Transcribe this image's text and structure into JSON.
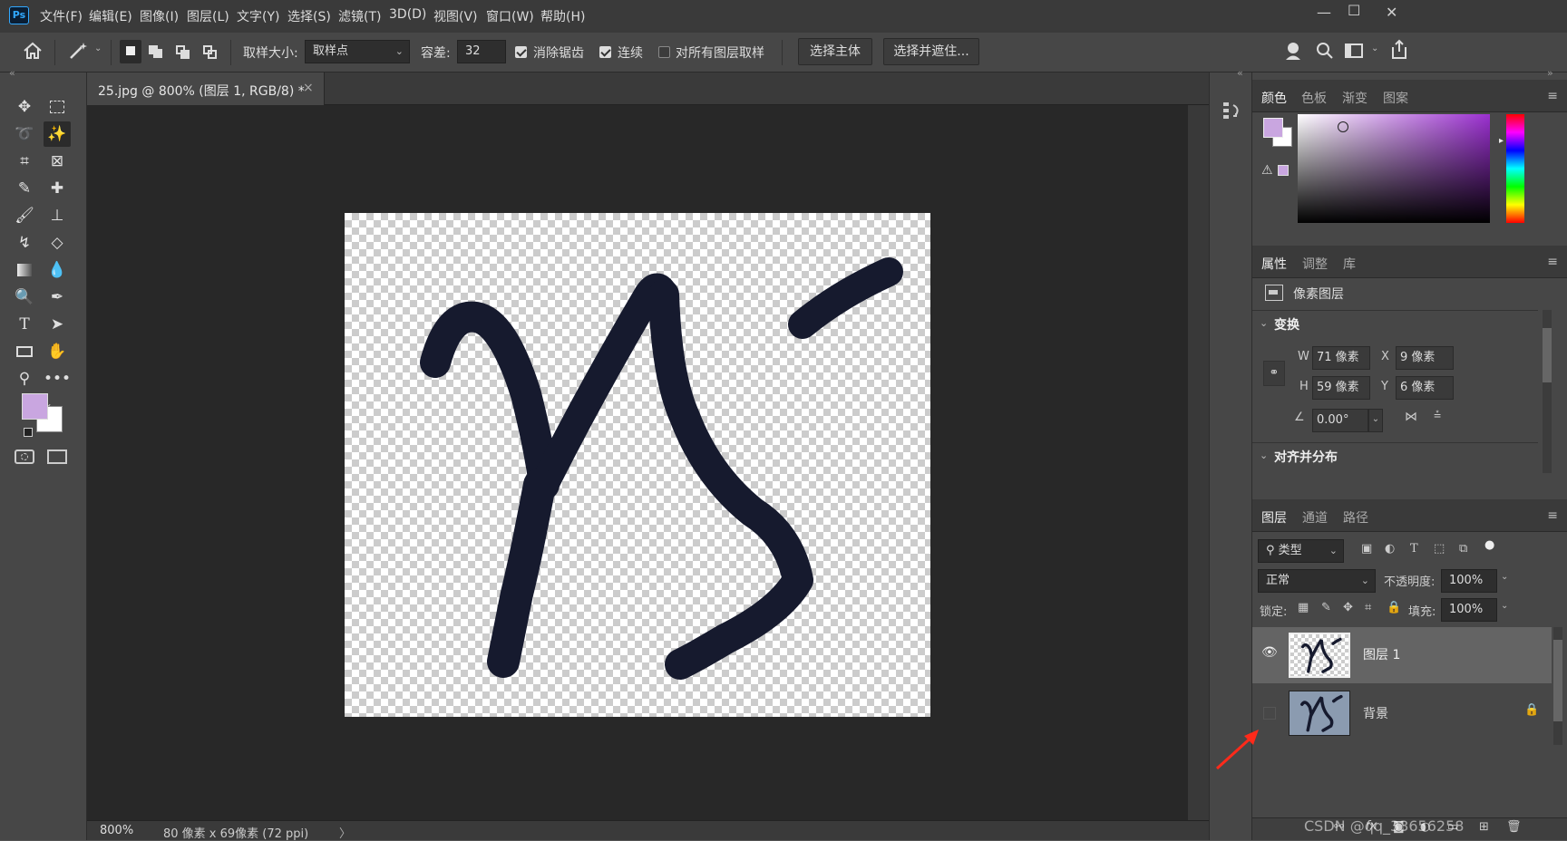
{
  "menubar": {
    "logo": "Ps",
    "items": [
      "文件(F)",
      "编辑(E)",
      "图像(I)",
      "图层(L)",
      "文字(Y)",
      "选择(S)",
      "滤镜(T)",
      "3D(D)",
      "视图(V)",
      "窗口(W)",
      "帮助(H)"
    ],
    "minimize": "—",
    "maximize": "☐",
    "close": "✕"
  },
  "options": {
    "sample_size_label": "取样大小:",
    "sample_size_value": "取样点",
    "tolerance_label": "容差:",
    "tolerance_value": "32",
    "anti_alias_label": "消除锯齿",
    "anti_alias_checked": true,
    "contiguous_label": "连续",
    "contiguous_checked": true,
    "all_layers_label": "对所有图层取样",
    "all_layers_checked": false,
    "select_subject": "选择主体",
    "select_mask": "选择并遮住..."
  },
  "document": {
    "tab_title": "25.jpg @ 800% (图层 1, RGB/8) *",
    "tab_close": "×",
    "zoom": "800%",
    "info": "80 像素 x 69像素 (72 ppi)",
    "info_arrow": "〉"
  },
  "colors": {
    "foreground": "#c9a6e0",
    "background": "#ffffff",
    "accent": "#9b30d0"
  },
  "color_panel": {
    "tabs": [
      "颜色",
      "色板",
      "渐变",
      "图案"
    ]
  },
  "properties_panel": {
    "tabs": [
      "属性",
      "调整",
      "库"
    ],
    "layer_type": "像素图层",
    "transform_label": "变换",
    "w_label": "W",
    "w_value": "71 像素",
    "h_label": "H",
    "h_value": "59 像素",
    "x_label": "X",
    "x_value": "9 像素",
    "y_label": "Y",
    "y_value": "6 像素",
    "angle_value": "0.00°",
    "align_label": "对齐并分布"
  },
  "layers_panel": {
    "tabs": [
      "图层",
      "通道",
      "路径"
    ],
    "filter_value": "类型",
    "blend_mode": "正常",
    "opacity_label": "不透明度:",
    "opacity_value": "100%",
    "lock_label": "锁定:",
    "fill_label": "填充:",
    "fill_value": "100%",
    "layers": [
      {
        "name": "图层 1",
        "visible": true
      },
      {
        "name": "背景",
        "visible": false,
        "locked": true
      }
    ]
  },
  "watermark": "CSDN @qq_33656258"
}
